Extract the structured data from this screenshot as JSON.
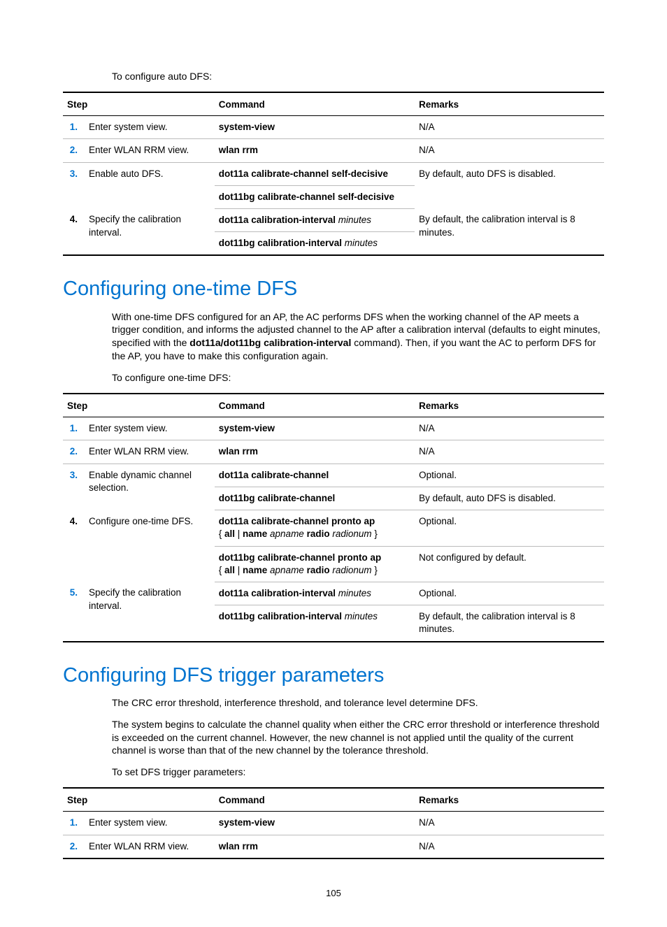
{
  "section1": {
    "intro": "To configure auto DFS:",
    "headers": {
      "step": "Step",
      "command": "Command",
      "remarks": "Remarks"
    },
    "rows": [
      {
        "num": "1.",
        "numClass": "num-blue",
        "step": "Enter system view.",
        "cmd": "system-view",
        "rem": "N/A"
      },
      {
        "num": "2.",
        "numClass": "num-blue",
        "step": "Enter WLAN RRM view.",
        "cmd": "wlan rrm",
        "rem": "N/A"
      }
    ],
    "row3": {
      "num": "3.",
      "numClass": "num-blue",
      "step": "Enable auto DFS.",
      "cmd_a": "dot11a calibrate-channel self-decisive",
      "cmd_b": "dot11bg calibrate-channel self-decisive",
      "rem": "By default, auto DFS is disabled."
    },
    "row4": {
      "num": "4.",
      "numClass": "num-black",
      "step": "Specify the calibration interval.",
      "cmd_a_prefix": "dot11a calibration-interval",
      "cmd_a_arg": " minutes",
      "cmd_b_prefix": "dot11bg calibration-interval",
      "cmd_b_arg": " minutes",
      "rem": "By default, the calibration interval is 8 minutes."
    }
  },
  "section2": {
    "title": "Configuring one-time DFS",
    "para_parts": {
      "p1": "With one-time DFS configured for an AP, the AC performs DFS when the working channel of the AP meets a trigger condition, and informs the adjusted channel to the AP after a calibration interval (defaults to eight minutes, specified with the ",
      "b1": "dot11a/dot11bg calibration-interval",
      "p2": " command). Then, if you want the AC to perform DFS for the AP, you have to make this configuration again."
    },
    "intro": "To configure one-time DFS:",
    "headers": {
      "step": "Step",
      "command": "Command",
      "remarks": "Remarks"
    },
    "rows12": [
      {
        "num": "1.",
        "numClass": "num-blue",
        "step": "Enter system view.",
        "cmd": "system-view",
        "rem": "N/A"
      },
      {
        "num": "2.",
        "numClass": "num-blue",
        "step": "Enter WLAN RRM view.",
        "cmd": "wlan rrm",
        "rem": "N/A"
      }
    ],
    "row3": {
      "num": "3.",
      "numClass": "num-blue",
      "step": "Enable dynamic channel selection.",
      "cmd_a": "dot11a calibrate-channel",
      "cmd_b": "dot11bg calibrate-channel",
      "rem_a": "Optional.",
      "rem_b": "By default, auto DFS is disabled."
    },
    "row4": {
      "num": "4.",
      "numClass": "num-black",
      "step": "Configure one-time DFS.",
      "cmd_a_l1": "dot11a calibrate-channel pronto ap",
      "cmd_a_l2": {
        "lb": "{ ",
        "b1": "all",
        "sep": " | ",
        "b2": "name",
        "i1": " apname ",
        "b3": "radio",
        "i2": " radionum",
        "rb": " }"
      },
      "cmd_b_l1": "dot11bg calibrate-channel pronto ap",
      "cmd_b_l2": {
        "lb": "{ ",
        "b1": "all",
        "sep": " | ",
        "b2": "name",
        "i1": " apname ",
        "b3": "radio",
        "i2": " radionum",
        "rb": " }"
      },
      "rem_a": "Optional.",
      "rem_b": "Not configured by default."
    },
    "row5": {
      "num": "5.",
      "numClass": "num-blue",
      "step": "Specify the calibration interval.",
      "cmd_a_prefix": "dot11a calibration-interval",
      "cmd_a_arg": " minutes",
      "cmd_b_prefix": "dot11bg calibration-interval",
      "cmd_b_arg": " minutes",
      "rem_a": "Optional.",
      "rem_b": "By default, the calibration interval is 8 minutes."
    }
  },
  "section3": {
    "title": "Configuring DFS trigger parameters",
    "para1": "The CRC error threshold, interference threshold, and tolerance level determine DFS.",
    "para2": "The system begins to calculate the channel quality when either the CRC error threshold or interference threshold is exceeded on the current channel. However, the new channel is not applied until the quality of the current channel is worse than that of the new channel by the tolerance threshold.",
    "intro": "To set DFS trigger parameters:",
    "headers": {
      "step": "Step",
      "command": "Command",
      "remarks": "Remarks"
    },
    "rows": [
      {
        "num": "1.",
        "numClass": "num-blue",
        "step": "Enter system view.",
        "cmd": "system-view",
        "rem": "N/A"
      },
      {
        "num": "2.",
        "numClass": "num-blue",
        "step": "Enter WLAN RRM view.",
        "cmd": "wlan rrm",
        "rem": "N/A"
      }
    ]
  },
  "page_number": "105"
}
